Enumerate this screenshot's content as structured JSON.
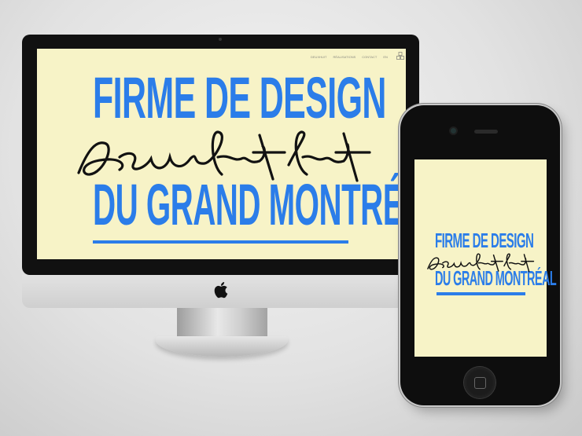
{
  "desktop": {
    "nav": [
      "DEUXHUIT",
      "RÉALISATIONS",
      "CONTACT",
      "EN"
    ],
    "headline_top": "FIRME DE DESIGN",
    "headline_bottom": "DU GRAND MONTRÉAL",
    "script_word": "Deuxhuithuit"
  },
  "mobile": {
    "headline_top": "FIRME DE DESIGN",
    "headline_bottom": "DU GRAND MONTRÉAL",
    "script_word": "Deuxhuithuit"
  },
  "colors": {
    "accent": "#2b7de9",
    "screen_bg": "#f7f3c7",
    "frame": "#111111"
  }
}
